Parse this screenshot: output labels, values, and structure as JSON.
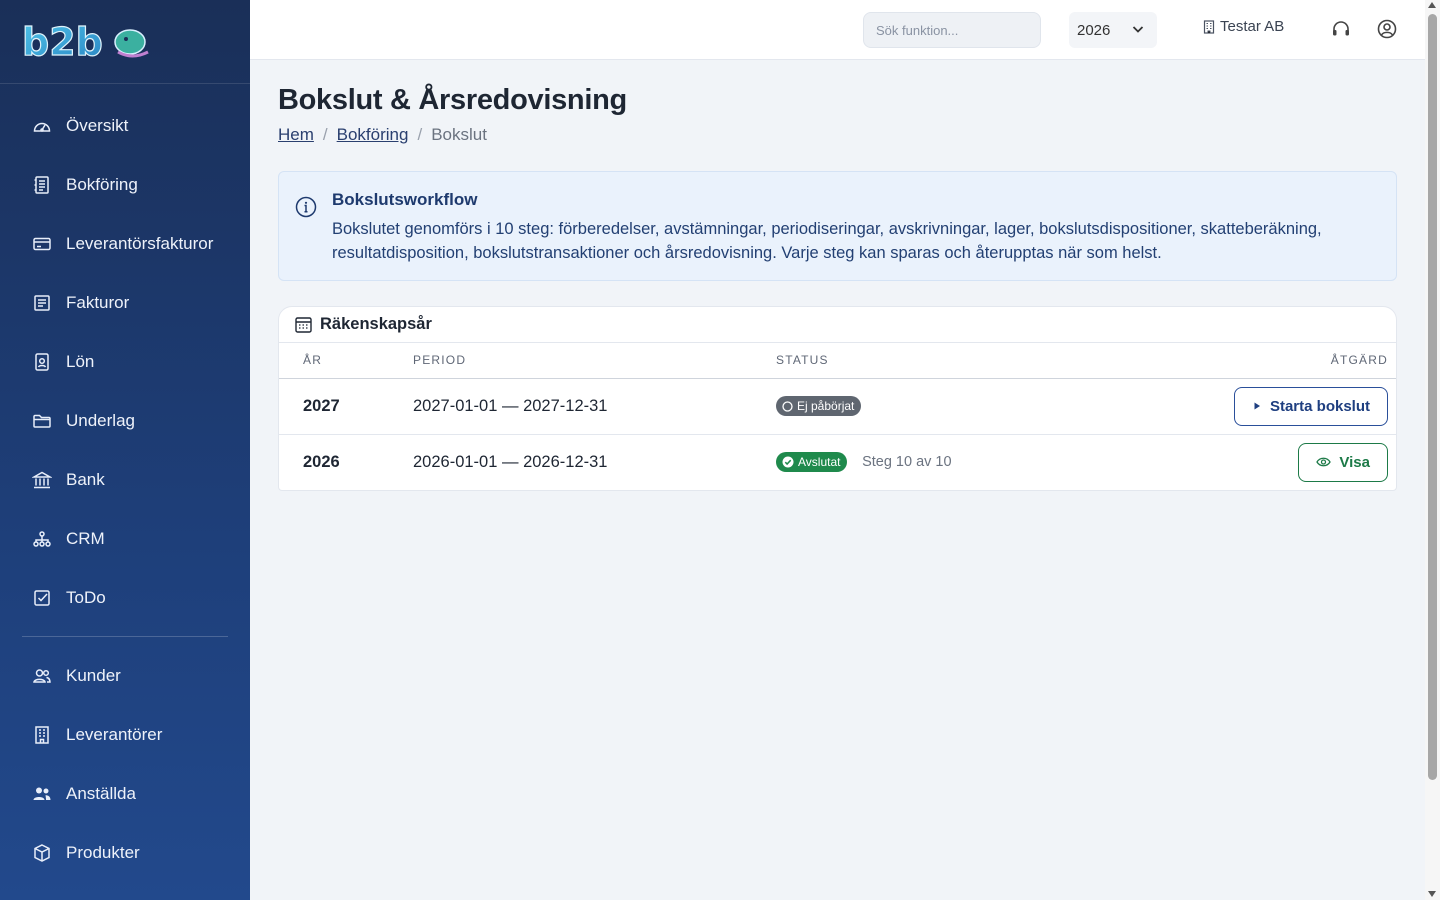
{
  "sidebar": {
    "logo_text": "b2b",
    "items": [
      {
        "label": "Översikt",
        "icon": "dashboard-gauge-icon"
      },
      {
        "label": "Bokföring",
        "icon": "ledger-icon"
      },
      {
        "label": "Leverantörsfakturor",
        "icon": "credit-card-icon"
      },
      {
        "label": "Fakturor",
        "icon": "invoice-icon"
      },
      {
        "label": "Lön",
        "icon": "id-badge-icon"
      },
      {
        "label": "Underlag",
        "icon": "folder-icon"
      },
      {
        "label": "Bank",
        "icon": "bank-icon"
      },
      {
        "label": "CRM",
        "icon": "network-icon"
      },
      {
        "label": "ToDo",
        "icon": "checkbox-icon"
      },
      {
        "label": "Kunder",
        "icon": "customers-icon"
      },
      {
        "label": "Leverantörer",
        "icon": "building-icon"
      },
      {
        "label": "Anställda",
        "icon": "employees-icon"
      },
      {
        "label": "Produkter",
        "icon": "box-icon"
      }
    ]
  },
  "topbar": {
    "search_placeholder": "Sök funktion...",
    "year": "2026",
    "company": "Testar AB"
  },
  "page": {
    "title": "Bokslut & Årsredovisning",
    "breadcrumb": [
      "Hem",
      "Bokföring",
      "Bokslut"
    ]
  },
  "info": {
    "title": "Bokslutsworkflow",
    "text": "Bokslutet genomförs i 10 steg: förberedelser, avstämningar, periodiseringar, avskrivningar, lager, bokslutsdispositioner, skatteberäkning, resultatdisposition, bokslutstransaktioner och årsredovisning. Varje steg kan sparas och återupptas när som helst."
  },
  "card": {
    "title": "Räkenskapsår",
    "columns": [
      "ÅR",
      "PERIOD",
      "STATUS",
      "ÅTGÄRD"
    ],
    "rows": [
      {
        "year": "2027",
        "period": "2027-01-01 — 2027-12-31",
        "status": "Ej påbörjat",
        "step": "",
        "action": "Starta bokslut"
      },
      {
        "year": "2026",
        "period": "2026-01-01 — 2026-12-31",
        "status": "Avslutat",
        "step": "Steg 10 av 10",
        "action": "Visa"
      }
    ]
  },
  "colors": {
    "sidebar_top": "#1a2f58",
    "sidebar_bottom": "#22498c",
    "accent_blue": "#1f3f80",
    "success_green": "#1f8a4c",
    "neutral_badge": "#5f6670"
  }
}
